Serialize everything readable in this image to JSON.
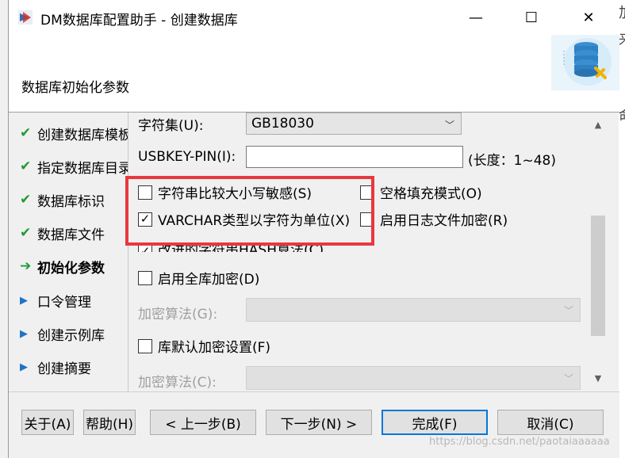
{
  "window": {
    "title": "DM数据库配置助手 - 创建数据库",
    "minimize": "—",
    "maximize": "☐",
    "close": "✕"
  },
  "header": {
    "title": "数据库初始化参数"
  },
  "outside_text": [
    "加",
    "来",
    "命"
  ],
  "nav": {
    "items": [
      {
        "label": "创建数据库模板",
        "status": "done"
      },
      {
        "label": "指定数据库目录",
        "status": "done"
      },
      {
        "label": "数据库标识",
        "status": "done"
      },
      {
        "label": "数据库文件",
        "status": "done"
      },
      {
        "label": "初始化参数",
        "status": "current"
      },
      {
        "label": "口令管理",
        "status": "pending"
      },
      {
        "label": "创建示例库",
        "status": "pending"
      },
      {
        "label": "创建摘要",
        "status": "pending"
      }
    ]
  },
  "form": {
    "charset_label": "字符集(U):",
    "charset_value": "GB18030",
    "usbkey_label": "USBKEY-PIN(I):",
    "usbkey_value": "",
    "usbkey_hint": "(长度：1~48)",
    "case_sensitive_label": "字符串比较大小写敏感(S)",
    "case_sensitive_checked": false,
    "blank_pad_label": "空格填充模式(O)",
    "blank_pad_checked": false,
    "varchar_char_label": "VARCHAR类型以字符为单位(X)",
    "varchar_char_checked": true,
    "log_encrypt_label": "启用日志文件加密(R)",
    "log_encrypt_checked": false,
    "hash_label": "改进的字符串HASH算法(C)",
    "hash_checked": true,
    "full_encrypt_label": "启用全库加密(D)",
    "full_encrypt_checked": false,
    "encrypt_alg_label": "加密算法(G):",
    "default_encrypt_label": "库默认加密设置(F)",
    "default_encrypt_checked": false,
    "encrypt_alg2_label": "加密算法(C):"
  },
  "buttons": {
    "about": "关于(A)",
    "help": "帮助(H)",
    "prev": "< 上一步(B)",
    "next": "下一步(N) >",
    "finish": "完成(F)",
    "cancel": "取消(C)"
  },
  "watermark": "https://blog.csdn.net/paotaiaaaaaa",
  "colors": {
    "highlight": "#e8383d",
    "check": "#1e9a3c",
    "arrow_pending": "#1e73c8",
    "primary_border": "#0078d7"
  },
  "icons": {
    "app": "dm-app-icon",
    "header": "database-settings-icon"
  }
}
